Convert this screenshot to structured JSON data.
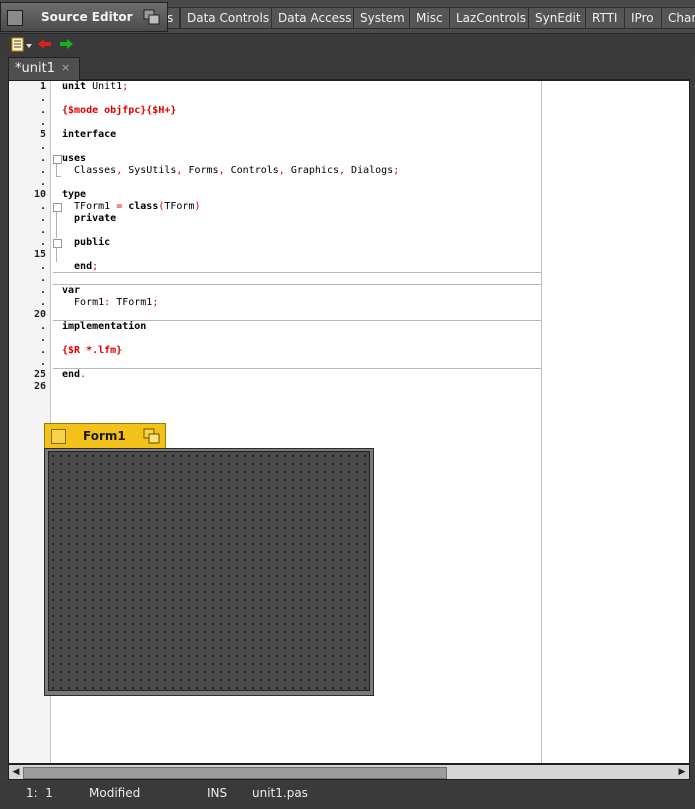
{
  "window": {
    "title": "Source Editor"
  },
  "palette": {
    "tabs": [
      "s",
      "Data Controls",
      "Data Access",
      "System",
      "Misc",
      "LazControls",
      "SynEdit",
      "RTTI",
      "IPro",
      "Char"
    ]
  },
  "toolbar": {
    "icons": [
      "document-list-icon",
      "back-arrow-icon",
      "forward-arrow-icon"
    ]
  },
  "editor": {
    "tab": {
      "label": "*unit1",
      "close": "×"
    },
    "line_numbers": [
      {
        "row": 1,
        "text": "1"
      },
      {
        "row": 2,
        "text": "."
      },
      {
        "row": 3,
        "text": "."
      },
      {
        "row": 4,
        "text": "."
      },
      {
        "row": 5,
        "text": "5"
      },
      {
        "row": 6,
        "text": "."
      },
      {
        "row": 7,
        "text": "."
      },
      {
        "row": 8,
        "text": "."
      },
      {
        "row": 9,
        "text": "."
      },
      {
        "row": 10,
        "text": "10"
      },
      {
        "row": 11,
        "text": "."
      },
      {
        "row": 12,
        "text": "."
      },
      {
        "row": 13,
        "text": "."
      },
      {
        "row": 14,
        "text": "."
      },
      {
        "row": 15,
        "text": "15"
      },
      {
        "row": 16,
        "text": "."
      },
      {
        "row": 17,
        "text": "."
      },
      {
        "row": 18,
        "text": "."
      },
      {
        "row": 19,
        "text": "."
      },
      {
        "row": 20,
        "text": "20"
      },
      {
        "row": 21,
        "text": "."
      },
      {
        "row": 22,
        "text": "."
      },
      {
        "row": 23,
        "text": "."
      },
      {
        "row": 24,
        "text": "."
      },
      {
        "row": 25,
        "text": "25"
      },
      {
        "row": 26,
        "text": "26"
      }
    ],
    "code": [
      {
        "row": 1,
        "parts": [
          {
            "t": "unit",
            "c": "kw"
          },
          {
            "t": " Unit1",
            "c": ""
          },
          {
            "t": ";",
            "c": "sym"
          }
        ]
      },
      {
        "row": 3,
        "parts": [
          {
            "t": "{$mode objfpc}{$H+}",
            "c": "dir"
          }
        ]
      },
      {
        "row": 5,
        "parts": [
          {
            "t": "interface",
            "c": "kw"
          }
        ]
      },
      {
        "row": 7,
        "parts": [
          {
            "t": "uses",
            "c": "kw"
          }
        ]
      },
      {
        "row": 8,
        "parts": [
          {
            "t": "  Classes",
            "c": ""
          },
          {
            "t": ",",
            "c": "sym"
          },
          {
            "t": " SysUtils",
            "c": ""
          },
          {
            "t": ",",
            "c": "sym"
          },
          {
            "t": " Forms",
            "c": ""
          },
          {
            "t": ",",
            "c": "sym"
          },
          {
            "t": " Controls",
            "c": ""
          },
          {
            "t": ",",
            "c": "sym"
          },
          {
            "t": " Graphics",
            "c": ""
          },
          {
            "t": ",",
            "c": "sym"
          },
          {
            "t": " Dialogs",
            "c": ""
          },
          {
            "t": ";",
            "c": "sym"
          }
        ]
      },
      {
        "row": 10,
        "parts": [
          {
            "t": "type",
            "c": "kw"
          }
        ]
      },
      {
        "row": 11,
        "parts": [
          {
            "t": "  TForm1 ",
            "c": ""
          },
          {
            "t": "=",
            "c": "sym"
          },
          {
            "t": " class",
            "c": "kw"
          },
          {
            "t": "(",
            "c": "sym"
          },
          {
            "t": "TForm",
            "c": ""
          },
          {
            "t": ")",
            "c": "sym"
          }
        ]
      },
      {
        "row": 12,
        "parts": [
          {
            "t": "  private",
            "c": "kw"
          }
        ]
      },
      {
        "row": 14,
        "parts": [
          {
            "t": "  public",
            "c": "kw"
          }
        ]
      },
      {
        "row": 16,
        "parts": [
          {
            "t": "  end",
            "c": "kw"
          },
          {
            "t": ";",
            "c": "sym"
          }
        ]
      },
      {
        "row": 18,
        "parts": [
          {
            "t": "var",
            "c": "kw"
          }
        ]
      },
      {
        "row": 19,
        "parts": [
          {
            "t": "  Form1",
            "c": ""
          },
          {
            "t": ":",
            "c": "sym"
          },
          {
            "t": " TForm1",
            "c": ""
          },
          {
            "t": ";",
            "c": "sym"
          }
        ]
      },
      {
        "row": 21,
        "parts": [
          {
            "t": "implementation",
            "c": "kw"
          }
        ]
      },
      {
        "row": 23,
        "parts": [
          {
            "t": "{$R *.lfm}",
            "c": "dir"
          }
        ]
      },
      {
        "row": 25,
        "parts": [
          {
            "t": "end",
            "c": "kw"
          },
          {
            "t": ".",
            "c": "sym"
          }
        ]
      }
    ]
  },
  "form_designer": {
    "title": "Form1"
  },
  "status_bar": {
    "position": "1:  1",
    "state": "Modified",
    "mode": "INS",
    "file": "unit1.pas"
  }
}
